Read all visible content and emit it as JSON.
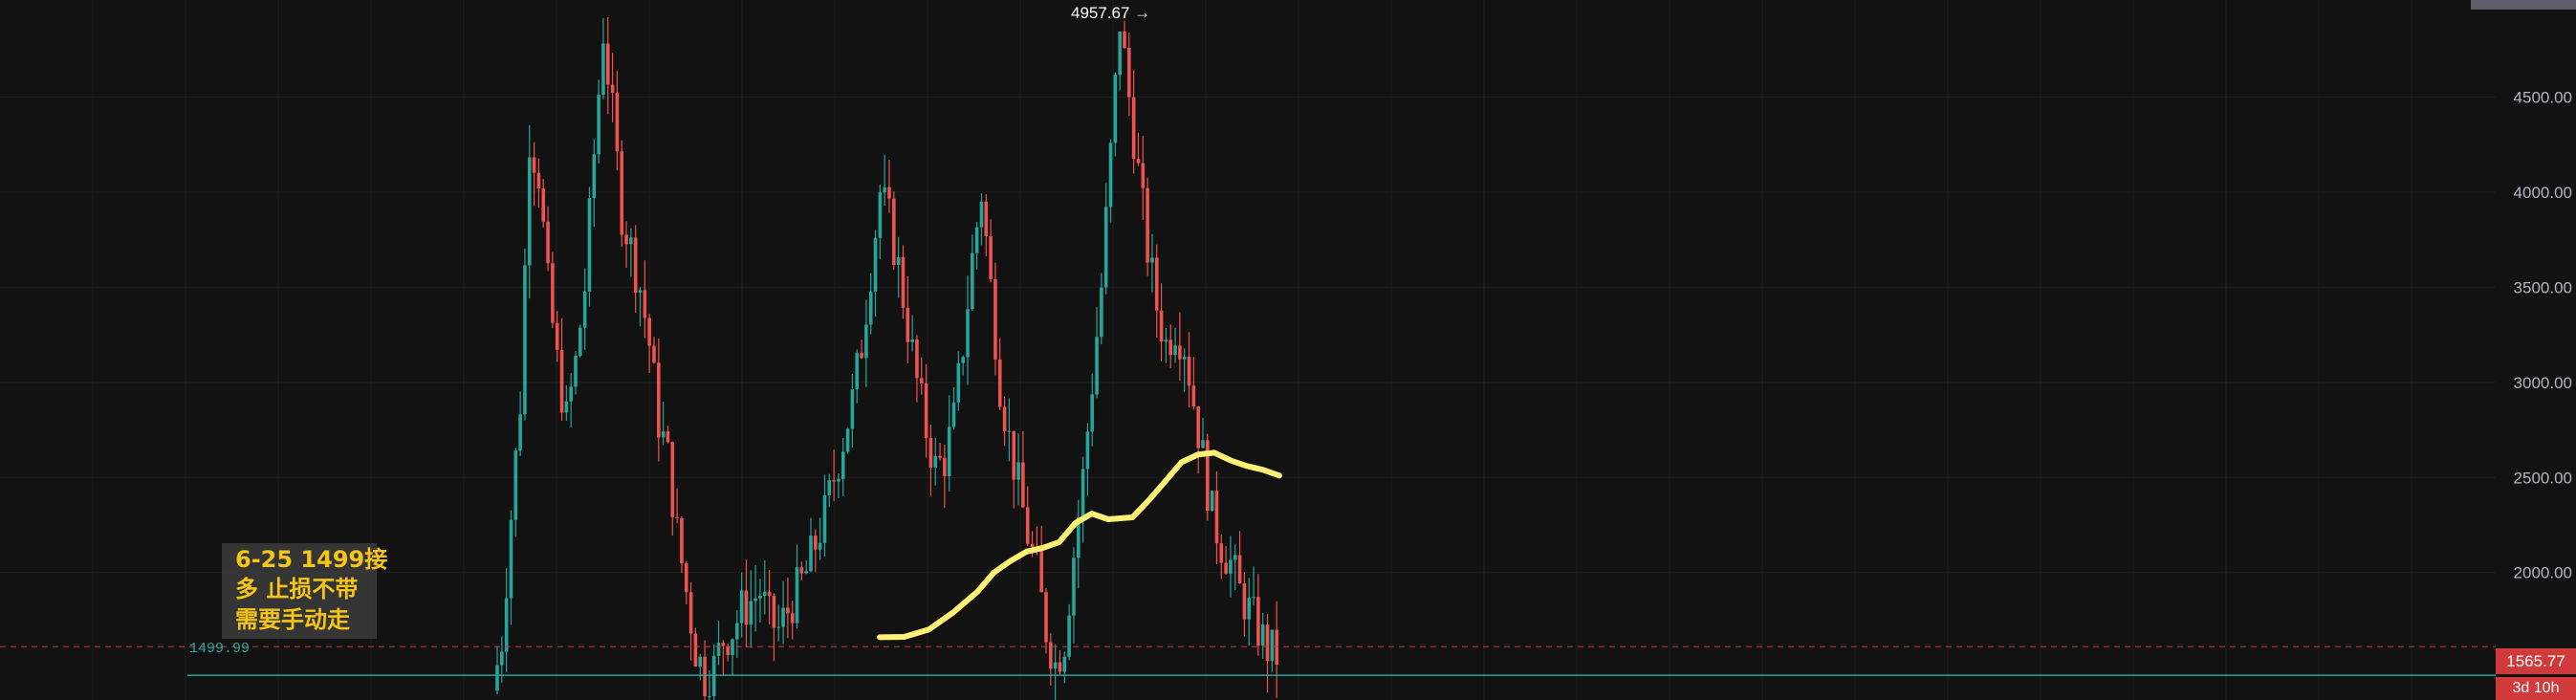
{
  "chart_data": {
    "type": "candlestick",
    "y_axis": {
      "ticks": [
        2000,
        2500,
        3000,
        3500,
        4000,
        4500
      ],
      "tick_labels": [
        "2000.00",
        "2500.00",
        "3000.00",
        "3500.00",
        "4000.00",
        "4500.00"
      ],
      "ylim": [
        1330,
        5010
      ]
    },
    "annotation": {
      "lines": [
        "6-25 1499接",
        "多  止损不带",
        "需要手动走"
      ]
    },
    "reference_line": {
      "value": 1499.99,
      "label": "1499.99",
      "color": "#26a69a"
    },
    "current_price": {
      "value": 1565.77,
      "label": "1565.77",
      "countdown": "3d 10h",
      "color": "#d03a3a"
    },
    "peak_label": {
      "value": 4957.67,
      "label": "4957.67 →"
    },
    "moving_average": {
      "color": "#fff176",
      "points": [
        [
          0,
          1660
        ],
        [
          3,
          1662
        ],
        [
          6,
          1700
        ],
        [
          9,
          1790
        ],
        [
          12,
          1900
        ],
        [
          14,
          2000
        ],
        [
          16,
          2060
        ],
        [
          18,
          2110
        ],
        [
          20,
          2130
        ],
        [
          22,
          2160
        ],
        [
          24,
          2260
        ],
        [
          26,
          2310
        ],
        [
          28,
          2280
        ],
        [
          31,
          2290
        ],
        [
          33,
          2380
        ],
        [
          35,
          2480
        ],
        [
          37,
          2580
        ],
        [
          39,
          2620
        ],
        [
          41,
          2630
        ],
        [
          43,
          2590
        ],
        [
          45,
          2560
        ],
        [
          47,
          2540
        ],
        [
          49,
          2510
        ]
      ]
    },
    "candles": {
      "up_color": "#26a69a",
      "down_color": "#ef5350",
      "closes": [
        1380,
        1650,
        2300,
        2900,
        4300,
        4100,
        3500,
        3100,
        2800,
        3100,
        3500,
        4200,
        4850,
        4400,
        3900,
        3700,
        3500,
        3200,
        2800,
        2600,
        2200,
        1900,
        1600,
        1450,
        1500,
        1650,
        1700,
        1800,
        1850,
        1900,
        1750,
        1700,
        1800,
        1900,
        2000,
        2150,
        2300,
        2500,
        2700,
        2900,
        3200,
        3600,
        4000,
        3850,
        3600,
        3300,
        3000,
        2750,
        2550,
        2600,
        2800,
        3200,
        3650,
        4000,
        3500,
        3000,
        2700,
        2450,
        2200,
        2000,
        1700,
        1520,
        1650,
        2100,
        2500,
        3000,
        3500,
        4200,
        4900,
        4500,
        4100,
        3700,
        3400,
        3200,
        3300,
        3200,
        2900,
        2600,
        2300,
        2150,
        2050,
        1900,
        1800,
        1700,
        1600,
        1565
      ],
      "start_x": 520,
      "step_x": 4.5
    }
  }
}
